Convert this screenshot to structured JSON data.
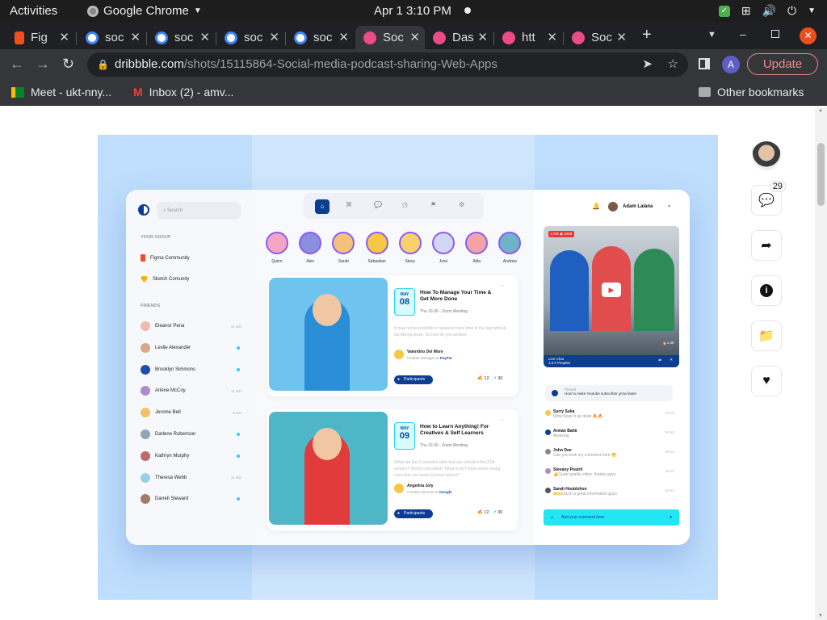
{
  "system": {
    "activities": "Activities",
    "app": "Google Chrome",
    "clock": "Apr 1  3:10 PM"
  },
  "tabs": [
    {
      "label": "Fig",
      "color": "#f24e1e"
    },
    {
      "label": "soc",
      "color": "#ffffff"
    },
    {
      "label": "soc",
      "color": "#ffffff"
    },
    {
      "label": "soc",
      "color": "#ffffff"
    },
    {
      "label": "soc",
      "color": "#ffffff"
    },
    {
      "label": "Soc",
      "color": "#ea4c89"
    },
    {
      "label": "Das",
      "color": "#ea4c89"
    },
    {
      "label": "htt",
      "color": "#ea4c89"
    },
    {
      "label": "Soc",
      "color": "#ea4c89"
    }
  ],
  "address": {
    "domain": "dribbble.com",
    "path": "/shots/15115864-Social-media-podcast-sharing-Web-Apps"
  },
  "profile_initial": "A",
  "update_label": "Update",
  "bookmarks": {
    "meet": "Meet - ukt-nny...",
    "inbox": "Inbox (2) - amv...",
    "other": "Other bookmarks"
  },
  "dribbble": {
    "comments_count": "29"
  },
  "design": {
    "search_placeholder": "Search",
    "your_group": "YOUR GROUP",
    "groups": [
      "Figma Community",
      "Sketch Comunity"
    ],
    "friends_label": "FRIENDS",
    "friends": [
      {
        "name": "Eleanor Pena",
        "time": "11 min",
        "online": false,
        "color": "#f0b9b4"
      },
      {
        "name": "Leslie Alexander",
        "time": "",
        "online": true,
        "color": "#d9a88a"
      },
      {
        "name": "Brooklyn Simmons",
        "time": "",
        "online": true,
        "color": "#1a4fb0"
      },
      {
        "name": "Arlene McCoy",
        "time": "11 min",
        "online": false,
        "color": "#b08bc9"
      },
      {
        "name": "Jerome Bell",
        "time": "9 min",
        "online": false,
        "color": "#f5c06b"
      },
      {
        "name": "Darlene Robertson",
        "time": "",
        "online": true,
        "color": "#8fa6b8"
      },
      {
        "name": "Kathryn Murphy",
        "time": "",
        "online": true,
        "color": "#c26a6a"
      },
      {
        "name": "Theresa Webb",
        "time": "11 min",
        "online": false,
        "color": "#9bd0e3"
      },
      {
        "name": "Darrell Steward",
        "time": "",
        "online": true,
        "color": "#a07c6a"
      }
    ],
    "user_name": "Adam Lalana",
    "stories": [
      {
        "name": "Quinn",
        "color": "#f2a6c2"
      },
      {
        "name": "Alex",
        "color": "#8b8fe0"
      },
      {
        "name": "Sarah",
        "color": "#f4c17a"
      },
      {
        "name": "Sebastian",
        "color": "#f7c844"
      },
      {
        "name": "Stevy",
        "color": "#f7d16a"
      },
      {
        "name": "Jose",
        "color": "#cfd7f2"
      },
      {
        "name": "Alita",
        "color": "#f3a3a3"
      },
      {
        "name": "Andrew",
        "color": "#6fb3c9"
      }
    ],
    "events": [
      {
        "month": "MAY",
        "day": "08",
        "title": "How To Manage Your Time & Get More Done",
        "when": "Thu 10.00 - Zoom Meeting",
        "desc": "It may not be possible to squeeze more time in the day without sacrificing sleep. So how do you achieve",
        "host": "Valentino Del More",
        "role": "Product Manager",
        "org": "PayPal",
        "participants": "Participants",
        "likes": "12",
        "shares": "30",
        "pic": "#6fc3ef"
      },
      {
        "month": "MAY",
        "day": "09",
        "title": "How to Learn Anything! For Creatives & Self Learners",
        "when": "Thu 10.00 - Zoom Meeting",
        "desc": "What are the 3 essential skills that are critical in the 21st century? School cancelled? What to do? Have some young ones that you need to home school?",
        "host": "Angelina Joly",
        "role": "Creative Director",
        "org": "Google",
        "participants": "Participants",
        "likes": "12",
        "shares": "30",
        "pic": "#4fb6c7"
      }
    ],
    "live": {
      "tag": "LIVE",
      "viewers": "2456",
      "chat_label": "Live Chat",
      "people": "1.5 k Peoples",
      "likes": "1.4K"
    },
    "pinned": {
      "label": "Pinned",
      "text": "How to make Youtube subscriber grow faster"
    },
    "chats": [
      {
        "name": "Surry Suka",
        "msg": "Wow Keep it up dude 🔥🔥",
        "time": "09:00"
      },
      {
        "name": "Arman Bahir",
        "msg": "Amazing",
        "time": "09:10"
      },
      {
        "name": "John Doe",
        "msg": "Can you look my comment here 😁",
        "time": "09:15"
      },
      {
        "name": "Stevany Postril",
        "msg": "👍Great quality video. thanks guys",
        "time": "09:20"
      },
      {
        "name": "Sarah Houtdshon",
        "msg": "🙌🙌Such a great information guys",
        "time": "09:22"
      }
    ],
    "comment_placeholder": "Add your comment here"
  }
}
